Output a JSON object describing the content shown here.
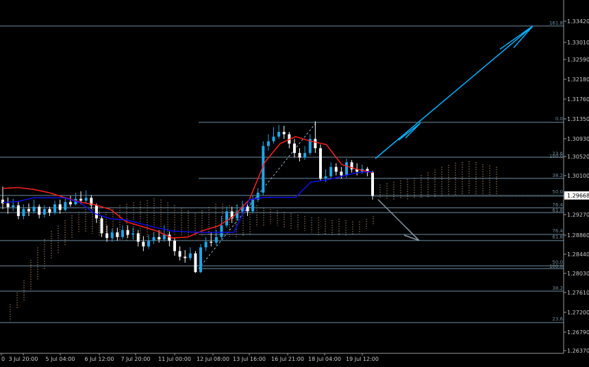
{
  "chart_data": {
    "type": "candlestick",
    "instrument_note": "",
    "colors": {
      "background": "#000000",
      "axis": "#c8c8c8",
      "bull_candle": "#1ea6e8",
      "bear_candle": "#ffffff",
      "tenkan": "#ff2020",
      "kijun": "#1010e6",
      "kumo": "#d2a070",
      "fib_line": "#8fb4cc",
      "arrow_up": "#00b4ff",
      "arrow_down": "#8898a8"
    },
    "y_ticks": [
      "1.33420",
      "1.33010",
      "1.32590",
      "1.32180",
      "1.31760",
      "1.31350",
      "1.30930",
      "1.30520",
      "1.30100",
      "1.29668",
      "1.29270",
      "1.28860",
      "1.28440",
      "1.28030",
      "1.27610",
      "1.27200",
      "1.26790",
      "1.26370"
    ],
    "current_price": "1.29668",
    "x_ticks": [
      "0",
      "3 Jul 20:00",
      "5 Jul 04:00",
      "6 Jul 12:00",
      "7 Jul 20:00",
      "11 Jul 00:00",
      "12 Jul 08:00",
      "13 Jul 16:00",
      "16 Jul 21:00",
      "18 Jul 04:00",
      "19 Jul 12:00"
    ],
    "fib_labels": [
      "161.8",
      "0.0",
      "23.6",
      "100.0",
      "38.2",
      "50.0",
      "76.4",
      "61.8",
      "76.4",
      "61.8",
      "50.0",
      "100.0",
      "38.2",
      "23.6"
    ],
    "ichimoku": {
      "tenkan": [
        1.2984,
        1.2986,
        1.2982,
        1.2975,
        1.2965,
        1.2955,
        1.2949,
        1.2939,
        1.2913,
        1.2903,
        1.2893,
        1.2878,
        1.288,
        1.2894,
        1.2904,
        1.2925,
        1.296,
        1.304,
        1.308,
        1.3095,
        1.3085,
        1.3078,
        1.3035,
        1.3025,
        1.3018
      ],
      "kijun": [
        1.2954,
        1.2956,
        1.2964,
        1.2964,
        1.2964,
        1.2954,
        1.293,
        1.2919,
        1.2917,
        1.2908,
        1.29,
        1.2893,
        1.2891,
        1.289,
        1.289,
        1.289,
        1.296,
        1.2965,
        1.2965,
        1.2965,
        1.2998,
        1.3002,
        1.301,
        1.3018,
        1.302
      ]
    },
    "candles": [
      [
        1.296,
        1.2952,
        1.2988,
        1.294
      ],
      [
        1.2952,
        1.2944,
        1.2965,
        1.293
      ],
      [
        1.2944,
        1.2948,
        1.2962,
        1.2936
      ],
      [
        1.2948,
        1.2925,
        1.2955,
        1.2918
      ],
      [
        1.2925,
        1.294,
        1.295,
        1.2918
      ],
      [
        1.294,
        1.2935,
        1.2952,
        1.2925
      ],
      [
        1.2935,
        1.2945,
        1.296,
        1.293
      ],
      [
        1.2945,
        1.2928,
        1.295,
        1.292
      ],
      [
        1.2928,
        1.294,
        1.2948,
        1.2922
      ],
      [
        1.294,
        1.2932,
        1.2945,
        1.2925
      ],
      [
        1.2932,
        1.295,
        1.2958,
        1.2928
      ],
      [
        1.295,
        1.2938,
        1.296,
        1.293
      ],
      [
        1.2938,
        1.2955,
        1.2965,
        1.2935
      ],
      [
        1.2955,
        1.295,
        1.2968,
        1.2945
      ],
      [
        1.295,
        1.2962,
        1.2975,
        1.2948
      ],
      [
        1.2962,
        1.2958,
        1.2978,
        1.295
      ],
      [
        1.2958,
        1.2964,
        1.298,
        1.2952
      ],
      [
        1.2964,
        1.2948,
        1.297,
        1.294
      ],
      [
        1.2948,
        1.292,
        1.2952,
        1.291
      ],
      [
        1.292,
        1.2888,
        1.2925,
        1.288
      ],
      [
        1.2888,
        1.2878,
        1.2905,
        1.287
      ],
      [
        1.2878,
        1.289,
        1.2898,
        1.287
      ],
      [
        1.289,
        1.288,
        1.29,
        1.2872
      ],
      [
        1.288,
        1.2895,
        1.2905,
        1.2875
      ],
      [
        1.2895,
        1.2885,
        1.2905,
        1.2878
      ],
      [
        1.2885,
        1.2888,
        1.29,
        1.2875
      ],
      [
        1.2888,
        1.287,
        1.2895,
        1.286
      ],
      [
        1.287,
        1.286,
        1.2882,
        1.285
      ],
      [
        1.286,
        1.2872,
        1.2885,
        1.2855
      ],
      [
        1.2872,
        1.288,
        1.289,
        1.2865
      ],
      [
        1.288,
        1.2875,
        1.2895,
        1.2868
      ],
      [
        1.2875,
        1.2885,
        1.2905,
        1.287
      ],
      [
        1.2885,
        1.2872,
        1.2892,
        1.286
      ],
      [
        1.2872,
        1.285,
        1.2878,
        1.284
      ],
      [
        1.285,
        1.2838,
        1.286,
        1.283
      ],
      [
        1.2838,
        1.2835,
        1.2852,
        1.2825
      ],
      [
        1.2835,
        1.2845,
        1.2858,
        1.283
      ],
      [
        1.2845,
        1.2805,
        1.285,
        1.2803
      ],
      [
        1.2805,
        1.2858,
        1.2865,
        1.2803
      ],
      [
        1.2858,
        1.287,
        1.288,
        1.285
      ],
      [
        1.287,
        1.2868,
        1.289,
        1.286
      ],
      [
        1.2868,
        1.288,
        1.2895,
        1.2862
      ],
      [
        1.288,
        1.2905,
        1.2925,
        1.2875
      ],
      [
        1.2905,
        1.2935,
        1.2945,
        1.29
      ],
      [
        1.2935,
        1.292,
        1.2945,
        1.291
      ],
      [
        1.292,
        1.2935,
        1.295,
        1.2915
      ],
      [
        1.2935,
        1.2945,
        1.2958,
        1.2928
      ],
      [
        1.2945,
        1.2935,
        1.2955,
        1.2925
      ],
      [
        1.2935,
        1.296,
        1.297,
        1.293
      ],
      [
        1.296,
        1.2975,
        1.2985,
        1.2955
      ],
      [
        1.2975,
        1.3075,
        1.3085,
        1.297
      ],
      [
        1.3075,
        1.3085,
        1.31,
        1.3065
      ],
      [
        1.3085,
        1.3095,
        1.3115,
        1.308
      ],
      [
        1.3095,
        1.3105,
        1.312,
        1.309
      ],
      [
        1.3105,
        1.31,
        1.3118,
        1.309
      ],
      [
        1.31,
        1.308,
        1.3105,
        1.307
      ],
      [
        1.308,
        1.306,
        1.309,
        1.305
      ],
      [
        1.306,
        1.305,
        1.307,
        1.3042
      ],
      [
        1.305,
        1.306,
        1.3075,
        1.3045
      ],
      [
        1.306,
        1.309,
        1.31,
        1.3055
      ],
      [
        1.309,
        1.307,
        1.3128,
        1.306
      ],
      [
        1.307,
        1.3005,
        1.3078,
        1.3
      ],
      [
        1.3005,
        1.301,
        1.3025,
        1.2998
      ],
      [
        1.301,
        1.303,
        1.304,
        1.3005
      ],
      [
        1.303,
        1.302,
        1.3038,
        1.3012
      ],
      [
        1.302,
        1.3012,
        1.303,
        1.3005
      ],
      [
        1.3012,
        1.304,
        1.3048,
        1.3008
      ],
      [
        1.304,
        1.3025,
        1.3045,
        1.3018
      ],
      [
        1.3025,
        1.302,
        1.3038,
        1.3012
      ],
      [
        1.302,
        1.3026,
        1.3035,
        1.3015
      ],
      [
        1.3026,
        1.3018,
        1.303,
        1.301
      ],
      [
        1.3018,
        1.2968,
        1.3022,
        1.296
      ]
    ]
  }
}
